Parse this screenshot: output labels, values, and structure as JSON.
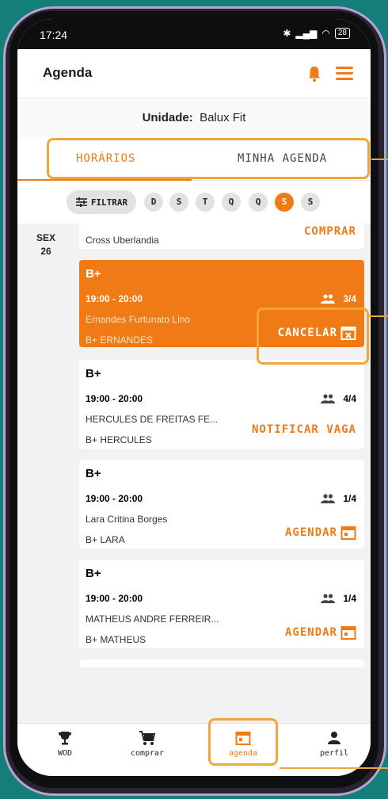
{
  "status": {
    "time": "17:24",
    "battery": "28"
  },
  "header": {
    "title": "Agenda"
  },
  "unit": {
    "label": "Unidade:",
    "value": "Balux Fit"
  },
  "tabs": [
    {
      "label": "HORÁRIOS"
    },
    {
      "label": "MINHA AGENDA"
    }
  ],
  "filter": {
    "label": "FILTRAR",
    "days": [
      "D",
      "S",
      "T",
      "Q",
      "Q",
      "S",
      "S"
    ],
    "active_index": 5
  },
  "date": {
    "weekday": "SEX",
    "day": "26"
  },
  "partial_card": {
    "name": "Cross Uberlandia",
    "action": "COMPRAR"
  },
  "cards": [
    {
      "title": "B+",
      "time": "19:00 - 20:00",
      "name": "Ernandes Furtunato Lino",
      "class": "B+ ERNANDES",
      "capacity": "3/4",
      "action": "CANCELAR",
      "highlight": true
    },
    {
      "title": "B+",
      "time": "19:00 - 20:00",
      "name": "HERCULES DE FREITAS FE...",
      "class": "B+ HERCULES",
      "capacity": "4/4",
      "action": "NOTIFICAR VAGA",
      "highlight": false
    },
    {
      "title": "B+",
      "time": "19:00 - 20:00",
      "name": "Lara Critina Borges",
      "class": "B+ LARA",
      "capacity": "1/4",
      "action": "AGENDAR",
      "highlight": false
    },
    {
      "title": "B+",
      "time": "19:00 - 20:00",
      "name": "MATHEUS ANDRE FERREIR...",
      "class": "B+ MATHEUS",
      "capacity": "1/4",
      "action": "AGENDAR",
      "highlight": false
    }
  ],
  "nav": [
    {
      "label": "WOD"
    },
    {
      "label": "comprar"
    },
    {
      "label": "agenda"
    },
    {
      "label": "perfil"
    }
  ],
  "colors": {
    "accent": "#f07a16",
    "annotation": "#f2a53a",
    "background": "#147f7a"
  }
}
